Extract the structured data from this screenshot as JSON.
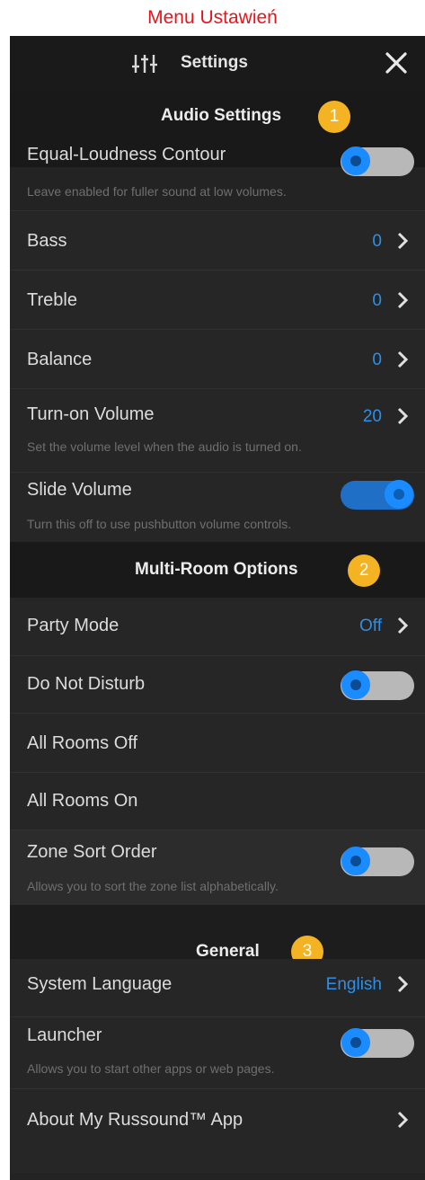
{
  "caption": "Menu Ustawień",
  "header": {
    "title": "Settings",
    "icon": "equalizer-icon",
    "close_icon": "close-icon"
  },
  "colors": {
    "accent": "#2f8fe6",
    "badge": "#f4b323",
    "caption": "#e8141b",
    "background": "#232323"
  },
  "audio": {
    "title": "Audio Settings",
    "badge": "1",
    "equal_loudness": {
      "label": "Equal-Loudness Contour",
      "desc": "Leave enabled for fuller sound at low volumes.",
      "state": "off"
    },
    "bass": {
      "label": "Bass",
      "value": "0"
    },
    "treble": {
      "label": "Treble",
      "value": "0"
    },
    "balance": {
      "label": "Balance",
      "value": "0"
    },
    "turn_on_volume": {
      "label": "Turn-on Volume",
      "value": "20",
      "desc": "Set the volume level when the audio is turned on."
    },
    "slide_volume": {
      "label": "Slide Volume",
      "desc": "Turn this off to use pushbutton volume controls.",
      "state": "on"
    }
  },
  "multiroom": {
    "title": "Multi-Room Options",
    "badge": "2",
    "party_mode": {
      "label": "Party Mode",
      "value": "Off"
    },
    "do_not_disturb": {
      "label": "Do Not Disturb",
      "state": "off"
    },
    "all_off": {
      "label": "All Rooms Off"
    },
    "all_on": {
      "label": "All Rooms On"
    },
    "zone_sort": {
      "label": "Zone Sort Order",
      "desc": "Allows you to sort the zone list alphabetically.",
      "state": "off"
    }
  },
  "general": {
    "title": "General",
    "badge": "3",
    "language": {
      "label": "System Language",
      "value": "English"
    },
    "launcher": {
      "label": "Launcher",
      "desc": "Allows you to start other apps or web pages.",
      "state": "off"
    },
    "about": {
      "label": "About My Russound™ App"
    }
  }
}
